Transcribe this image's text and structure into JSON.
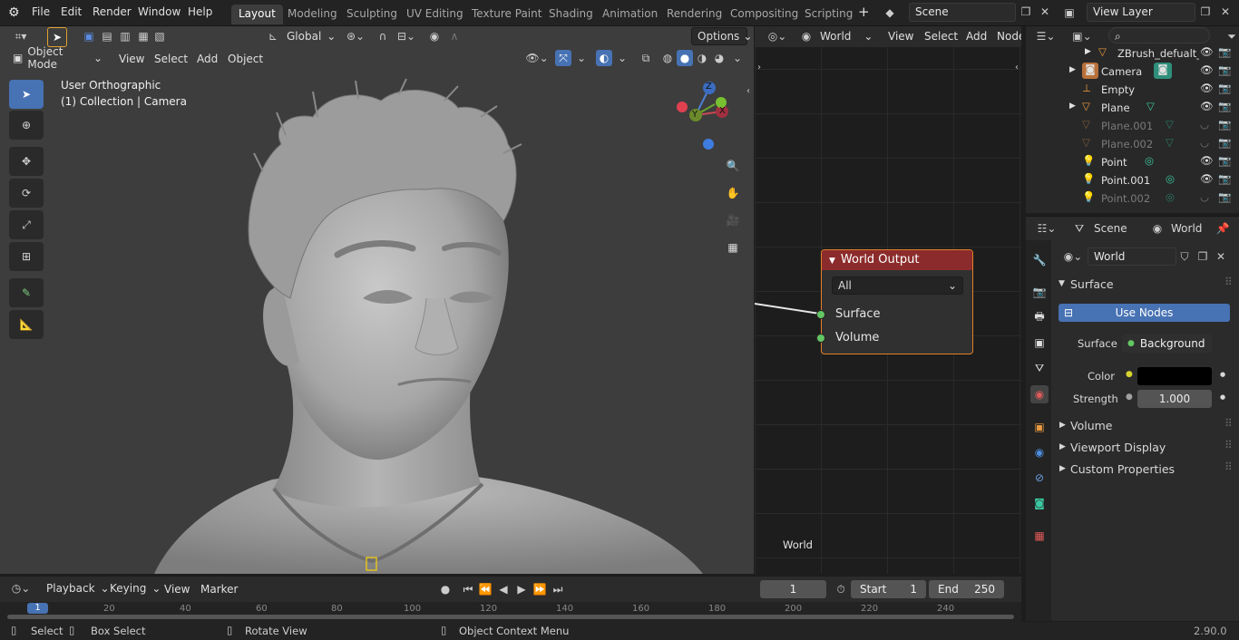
{
  "topbar": {
    "menus": [
      "File",
      "Edit",
      "Render",
      "Window",
      "Help"
    ],
    "workspaces": [
      "Layout",
      "Modeling",
      "Sculpting",
      "UV Editing",
      "Texture Paint",
      "Shading",
      "Animation",
      "Rendering",
      "Compositing",
      "Scripting"
    ],
    "active_workspace": "Layout",
    "add_tab": "+",
    "scene": "Scene",
    "view_layer": "View Layer"
  },
  "viewport": {
    "transform_orientation": "Global",
    "options_label": "Options",
    "mode": "Object Mode",
    "menus": [
      "View",
      "Select",
      "Add",
      "Object"
    ],
    "overlay_line1": "User Orthographic",
    "overlay_line2": "(1) Collection | Camera",
    "gizmo": {
      "z": "Z",
      "y": "Y",
      "x": "X"
    }
  },
  "node_editor": {
    "shader_type": "World",
    "menus": [
      "View",
      "Select",
      "Add",
      "Node"
    ],
    "node_title": "World Output",
    "target": "All",
    "sockets": [
      "Surface",
      "Volume"
    ],
    "footer_label": "World"
  },
  "outliner": {
    "search_placeholder": "",
    "rows": [
      {
        "name": "ZBrush_defualt_g",
        "dim": false
      },
      {
        "name": "Camera",
        "dim": false
      },
      {
        "name": "Empty",
        "dim": false
      },
      {
        "name": "Plane",
        "dim": false
      },
      {
        "name": "Plane.001",
        "dim": true
      },
      {
        "name": "Plane.002",
        "dim": true
      },
      {
        "name": "Point",
        "dim": false
      },
      {
        "name": "Point.001",
        "dim": false
      },
      {
        "name": "Point.002",
        "dim": true
      }
    ]
  },
  "properties": {
    "breadcrumb_scene": "Scene",
    "breadcrumb_world": "World",
    "datablock": "World",
    "panel_surface": "Surface",
    "use_nodes_label": "Use Nodes",
    "surface_label": "Surface",
    "surface_value": "Background",
    "color_label": "Color",
    "color_value": "#000000",
    "strength_label": "Strength",
    "strength_value": "1.000",
    "collapsed_panels": [
      "Volume",
      "Viewport Display",
      "Custom Properties"
    ]
  },
  "timeline": {
    "menus": [
      "Playback",
      "Keying",
      "View",
      "Marker"
    ],
    "current_frame": "1",
    "start_label": "Start",
    "start_value": "1",
    "end_label": "End",
    "end_value": "250",
    "ruler": [
      "1",
      "20",
      "40",
      "60",
      "80",
      "100",
      "120",
      "140",
      "160",
      "180",
      "200",
      "220",
      "240"
    ]
  },
  "statusbar": {
    "select": "Select",
    "box_select": "Box Select",
    "rotate_view": "Rotate View",
    "context_menu": "Object Context Menu",
    "version": "2.90.0"
  },
  "colors": {
    "accent": "#4772b3",
    "node_header": "#8c2b2b",
    "socket": "#63c763",
    "active_outline": "#e0802a"
  }
}
